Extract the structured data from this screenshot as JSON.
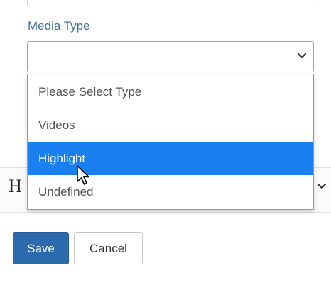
{
  "form": {
    "media_type_label": "Media Type",
    "media_type_value": ""
  },
  "dropdown": {
    "options": [
      {
        "label": "Please Select Type",
        "selected": false
      },
      {
        "label": "Videos",
        "selected": false
      },
      {
        "label": "Highlight",
        "selected": true
      },
      {
        "label": "Undefined",
        "selected": false
      }
    ]
  },
  "background": {
    "partial_glyph": "H"
  },
  "actions": {
    "save_label": "Save",
    "cancel_label": "Cancel"
  },
  "colors": {
    "label": "#3d6fa0",
    "selected_option": "#1a7ff0",
    "save_button": "#2c6aad"
  },
  "icons": {
    "select_arrow": "chevron-down-icon",
    "pointer": "cursor-pointer-icon"
  }
}
